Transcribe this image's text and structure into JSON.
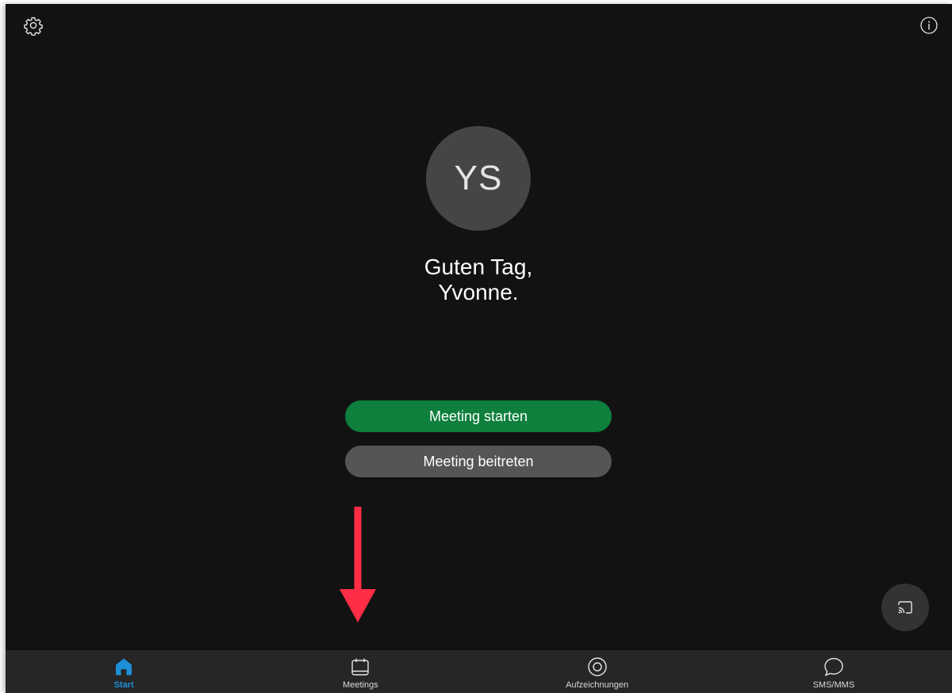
{
  "header": {
    "settings_icon": "gear-icon",
    "info_icon": "info-icon"
  },
  "profile": {
    "initials": "YS",
    "greeting_line1": "Guten Tag,",
    "greeting_line2": "Yvonne."
  },
  "actions": {
    "start_label": "Meeting starten",
    "join_label": "Meeting beitreten"
  },
  "annotation": {
    "arrow_color": "#ff2d45",
    "arrow_icon": "arrow-down-icon"
  },
  "cast": {
    "icon": "screen-share-icon"
  },
  "tabbar": {
    "items": [
      {
        "label": "Start",
        "icon": "home-icon",
        "active": true
      },
      {
        "label": "Meetings",
        "icon": "calendar-icon",
        "active": false
      },
      {
        "label": "Aufzeichnungen",
        "icon": "record-icon",
        "active": false
      },
      {
        "label": "SMS/MMS",
        "icon": "chat-bubble-icon",
        "active": false
      }
    ]
  },
  "colors": {
    "background": "#121212",
    "primary_button": "#0e7f3c",
    "secondary_button": "#555555",
    "active_tab": "#1d8fd8",
    "tabbar": "#262626"
  }
}
